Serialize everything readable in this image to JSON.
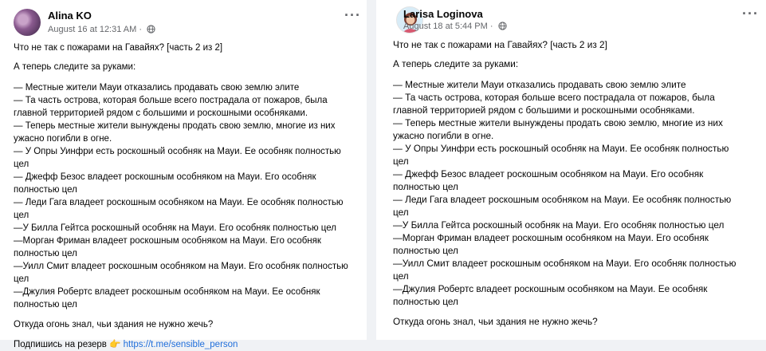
{
  "posts": [
    {
      "author": "Alina KO",
      "timestamp": "August 16 at 12:31 AM",
      "title_line": "Что не так с пожарами на Гавайях? [часть 2 из 2]",
      "intro": "А теперь следите за руками:",
      "lines": [
        "— Местные жители Мауи отказались продавать свою землю элите",
        "— Та часть острова, которая больше всего пострадала от пожаров, была",
        "главной территорией рядом с большими и роскошными особняками.",
        "— Теперь местные жители вынуждены продать свою землю, многие из них",
        "ужасно погибли в огне.",
        "— У Опры Уинфри есть роскошный особняк на Мауи. Ее особняк полностью",
        "цел",
        "— Джефф Безос владеет роскошным особняком на Мауи. Его особняк",
        "полностью цел",
        "— Леди Гага владеет роскошным особняком на Мауи. Ее особняк полностью",
        "цел",
        "—У Билла Гейтса роскошный особняк на Мауи. Его особняк полностью цел",
        "—Морган Фриман владеет роскошным особняком на Мауи. Его особняк",
        "полностью цел",
        "—Уилл Смит владеет роскошным особняком на Мауи. Его особняк полностью",
        "цел",
        "—Джулия Робертс владеет роскошным особняком на Мауи. Ее особняк",
        "полностью цел"
      ],
      "closing": "Откуда огонь знал, чьи здания не нужно жечь?",
      "subscribe_text": "Подпишись на резерв",
      "subscribe_emoji": "👉",
      "subscribe_link": "https://t.me/sensible_person"
    },
    {
      "author": "Larisa Loginova",
      "timestamp": "August 18 at 5:44 PM",
      "title_line": "Что не так с пожарами на Гавайях? [часть 2 из 2]",
      "intro": "А теперь следите за руками:",
      "lines": [
        "— Местные жители Мауи отказались продавать свою землю элите",
        "— Та часть острова, которая больше всего пострадала от пожаров, была",
        "главной территорией рядом с большими и роскошными особняками.",
        "— Теперь местные жители вынуждены продать свою землю, многие из них",
        "ужасно погибли в огне.",
        "— У Опры Уинфри есть роскошный особняк на Мауи. Ее особняк полностью",
        "цел",
        "— Джефф Безос владеет роскошным особняком на Мауи. Его особняк",
        "полностью цел",
        "— Леди Гага владеет роскошным особняком на Мауи. Ее особняк полностью",
        "цел",
        "—У Билла Гейтса роскошный особняк на Мауи. Его особняк полностью цел",
        "—Морган Фриман владеет роскошным особняком на Мауи. Его особняк",
        "полностью цел",
        "—Уилл Смит владеет роскошным особняком на Мауи. Его особняк полностью",
        "цел",
        "—Джулия Робертс владеет роскошным особняком на Мауи. Ее особняк",
        "полностью цел"
      ],
      "closing": "Откуда огонь знал, чьи здания не нужно жечь?"
    }
  ],
  "icons": {
    "more": "more-options-icon",
    "audience": "globe-icon"
  },
  "colors": {
    "link": "#216fdb",
    "meta": "#65676b",
    "background": "#f0f2f5"
  }
}
